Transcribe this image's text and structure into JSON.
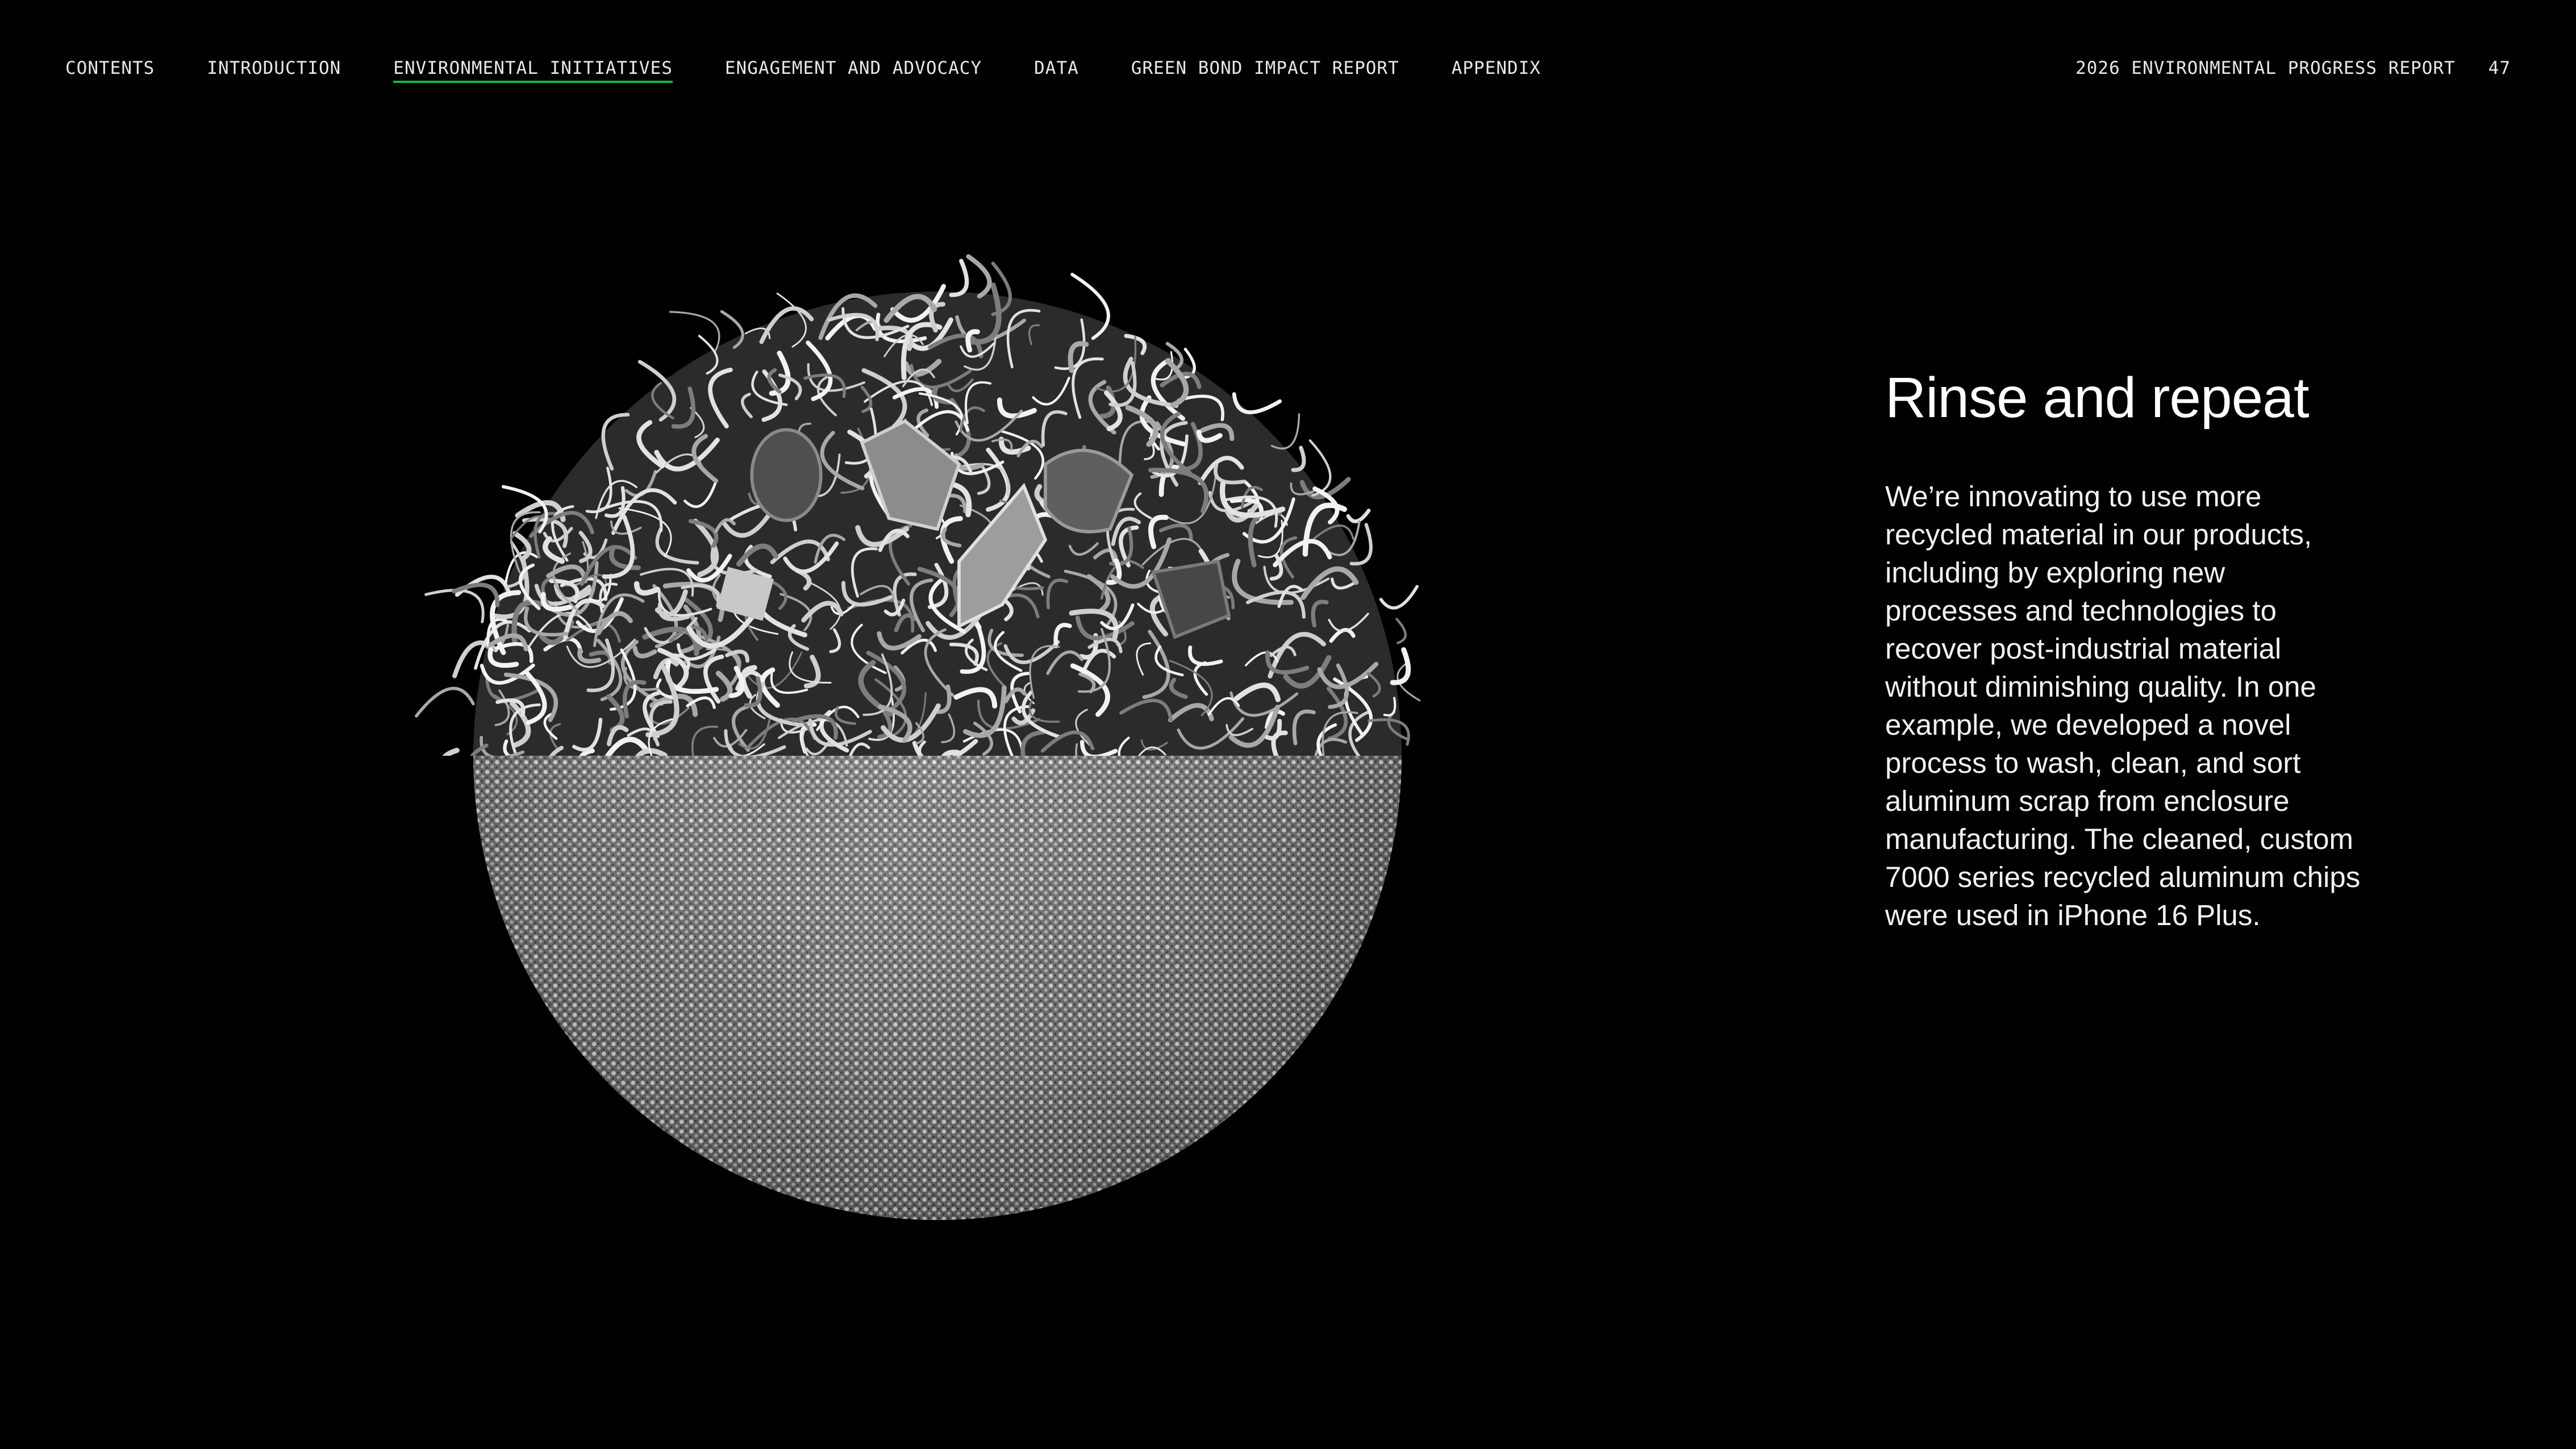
{
  "nav": {
    "items": [
      {
        "label": "CONTENTS",
        "active": false
      },
      {
        "label": "INTRODUCTION",
        "active": false
      },
      {
        "label": "ENVIRONMENTAL INITIATIVES",
        "active": true
      },
      {
        "label": "ENGAGEMENT AND ADVOCACY",
        "active": false
      },
      {
        "label": "DATA",
        "active": false
      },
      {
        "label": "GREEN BOND IMPACT REPORT",
        "active": false
      },
      {
        "label": "APPENDIX",
        "active": false
      }
    ],
    "active_underline_color": "#19b34a"
  },
  "report": {
    "title": "2026 ENVIRONMENTAL PROGRESS REPORT",
    "page_number": "47"
  },
  "content": {
    "headline": "Rinse and repeat",
    "body": "We’re innovating to use more recycled material in our products, including by exploring new processes and technologies to recover post-industrial material without diminishing quality. In one example, we developed a novel process to wash, clean, and sort aluminum scrap from enclosure manufacturing. The cleaned, custom 7000 series recycled aluminum chips were used in iPhone 16 Plus."
  },
  "image": {
    "icon": "aluminum-scrap-sphere"
  },
  "colors": {
    "background": "#000000",
    "text": "#ffffff",
    "accent": "#19b34a"
  }
}
